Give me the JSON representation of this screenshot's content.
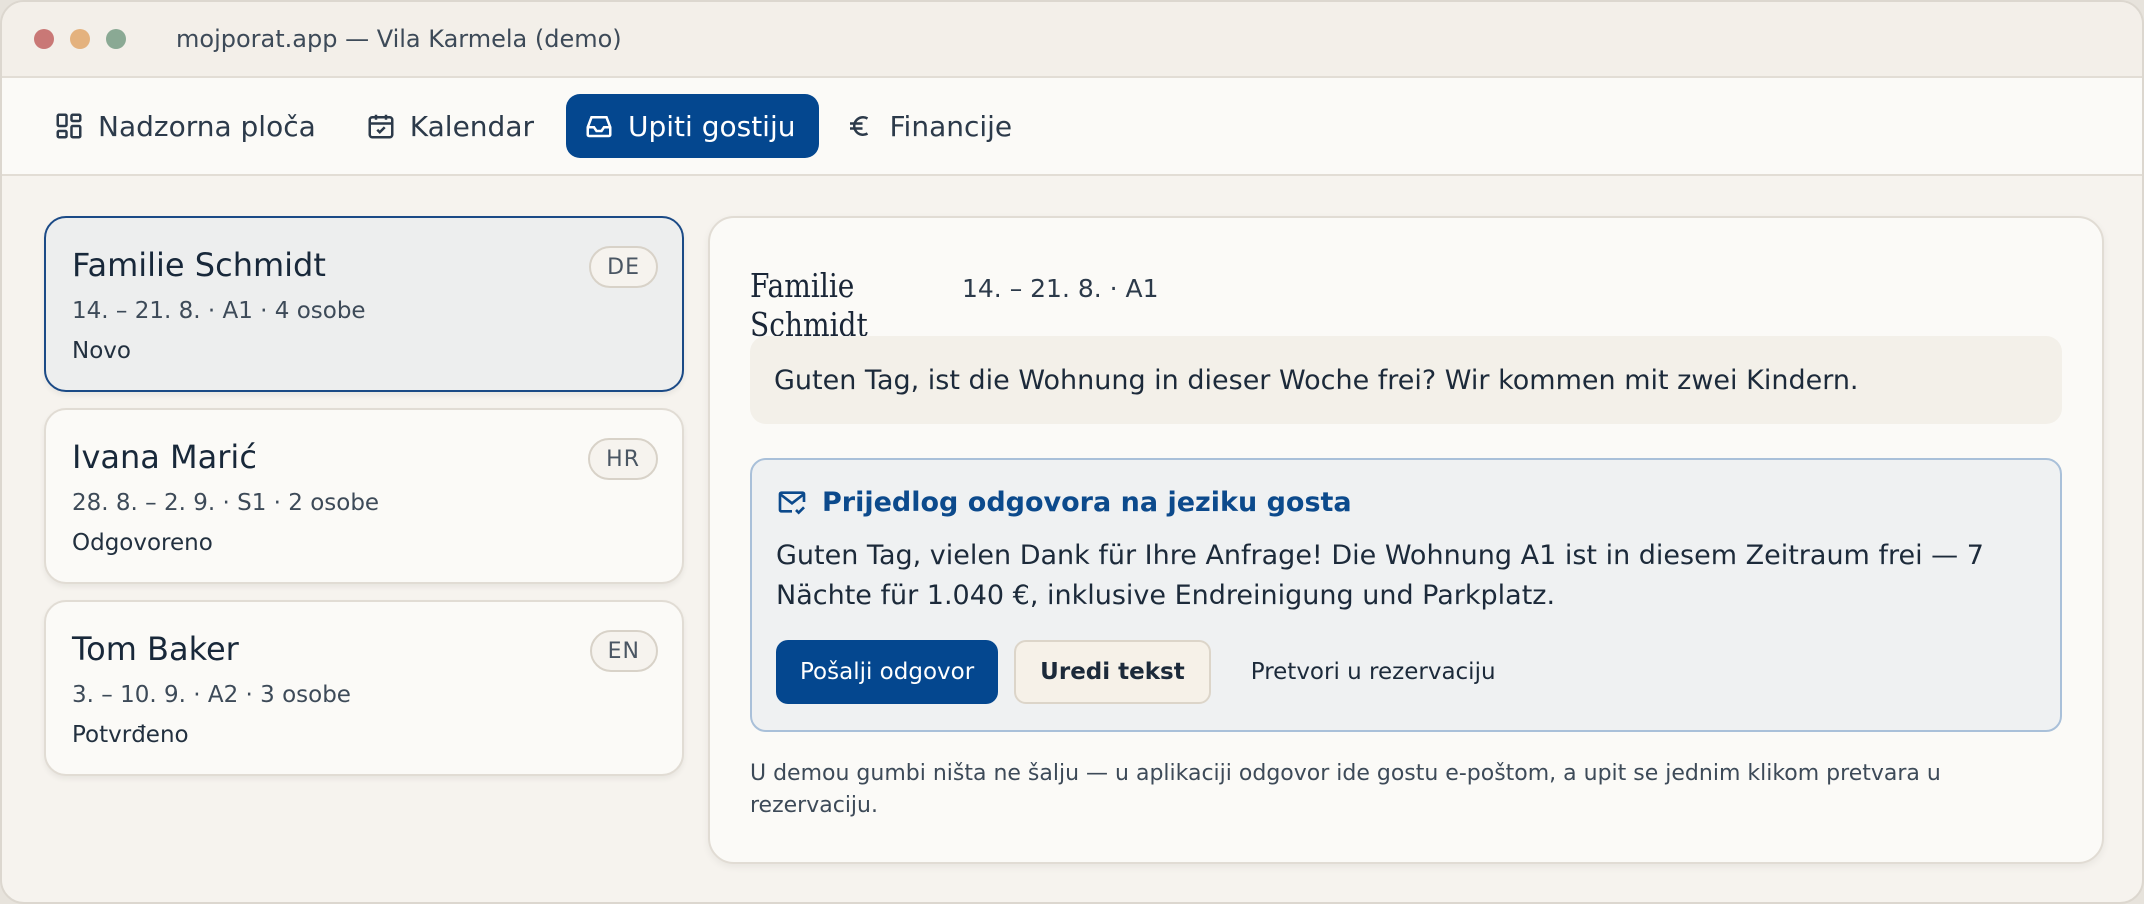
{
  "window": {
    "title": "mojporat.app — Vila Karmela (demo)"
  },
  "nav": {
    "tabs": [
      {
        "label": "Nadzorna ploča",
        "icon": "dashboard-icon",
        "active": false
      },
      {
        "label": "Kalendar",
        "icon": "calendar-check-icon",
        "active": false
      },
      {
        "label": "Upiti gostiju",
        "icon": "inbox-icon",
        "active": true
      },
      {
        "label": "Financije",
        "icon": "euro-icon",
        "active": false
      }
    ]
  },
  "inquiries": [
    {
      "name": "Familie Schmidt",
      "lang": "DE",
      "meta": "14. – 21. 8. · A1 · 4 osobe",
      "status": "Novo",
      "selected": true
    },
    {
      "name": "Ivana Marić",
      "lang": "HR",
      "meta": "28. 8. – 2. 9. · S1 · 2 osobe",
      "status": "Odgovoreno",
      "selected": false
    },
    {
      "name": "Tom Baker",
      "lang": "EN",
      "meta": "3. – 10. 9. · A2 · 3 osobe",
      "status": "Potvrđeno",
      "selected": false
    }
  ],
  "detail": {
    "name": "Familie Schmidt",
    "dates": "14. – 21. 8. · A1",
    "guest_message": "Guten Tag, ist die Wohnung in dieser Woche frei? Wir kommen mit zwei Kindern.",
    "reply": {
      "icon": "mail-check-icon",
      "title": "Prijedlog odgovora na jeziku gosta",
      "text": "Guten Tag, vielen Dank für Ihre Anfrage! Die Wohnung A1 ist in diesem Zeitraum frei — 7 Nächte für 1.040 €, inklusive Endreinigung und Parkplatz.",
      "send_label": "Pošalji odgovor",
      "edit_label": "Uredi tekst",
      "convert_label": "Pretvori u rezervaciju"
    },
    "footnote": "U demou gumbi ništa ne šalju — u aplikaciji odgovor ide gostu e-poštom, a upit se jednim klikom pretvara u rezervaciju."
  },
  "colors": {
    "accent": "#04478f",
    "background": "#f6f3ee",
    "reply_border": "#a9c0d9"
  }
}
